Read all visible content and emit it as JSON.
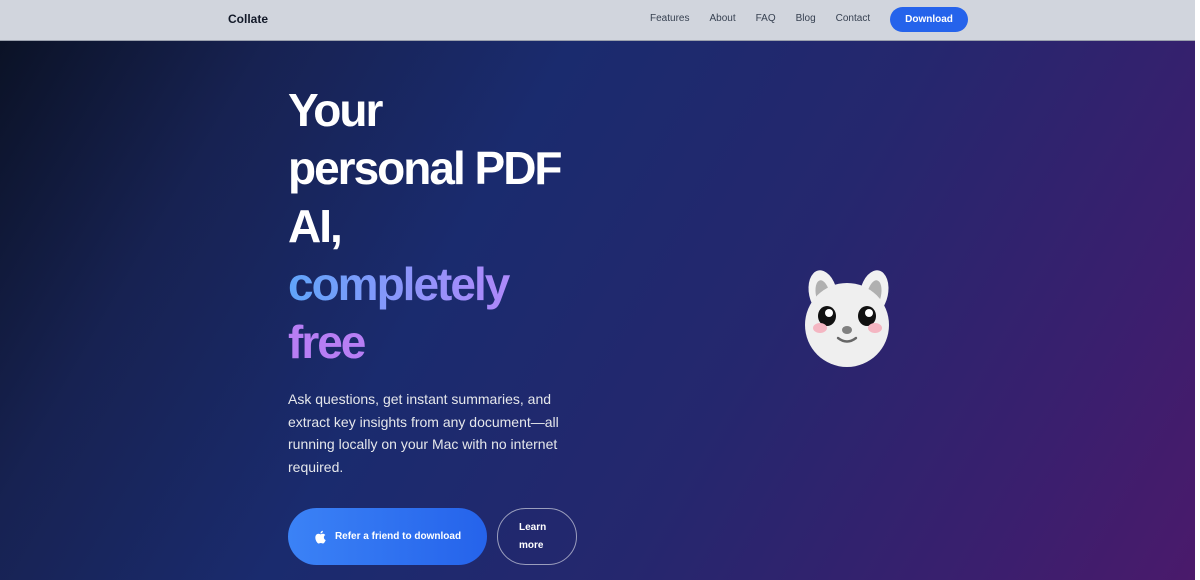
{
  "header": {
    "brand": "Collate",
    "nav": [
      "Features",
      "About",
      "FAQ",
      "Blog",
      "Contact"
    ],
    "cta": "Download"
  },
  "hero": {
    "headline_lines": [
      "Your",
      "personal PDF",
      "AI,"
    ],
    "headline_highlight": "completely",
    "headline_highlight_2": "free",
    "subtext": "Ask questions, get instant summaries, and extract key insights from any document—all running locally on your Mac with no internet required.",
    "primary_button": "Refer a friend to download",
    "secondary_button_line1": "Learn",
    "secondary_button_line2": "more",
    "primary_icon": "apple-icon",
    "mascot_icon": "bunny-mascot-icon"
  },
  "colors": {
    "accent": "#2563eb",
    "hero_gradient_start": "#0b1226",
    "hero_gradient_end": "#4a1a6b",
    "highlight_blue": "#60a5fa",
    "highlight_purple": "#b77ef4"
  }
}
